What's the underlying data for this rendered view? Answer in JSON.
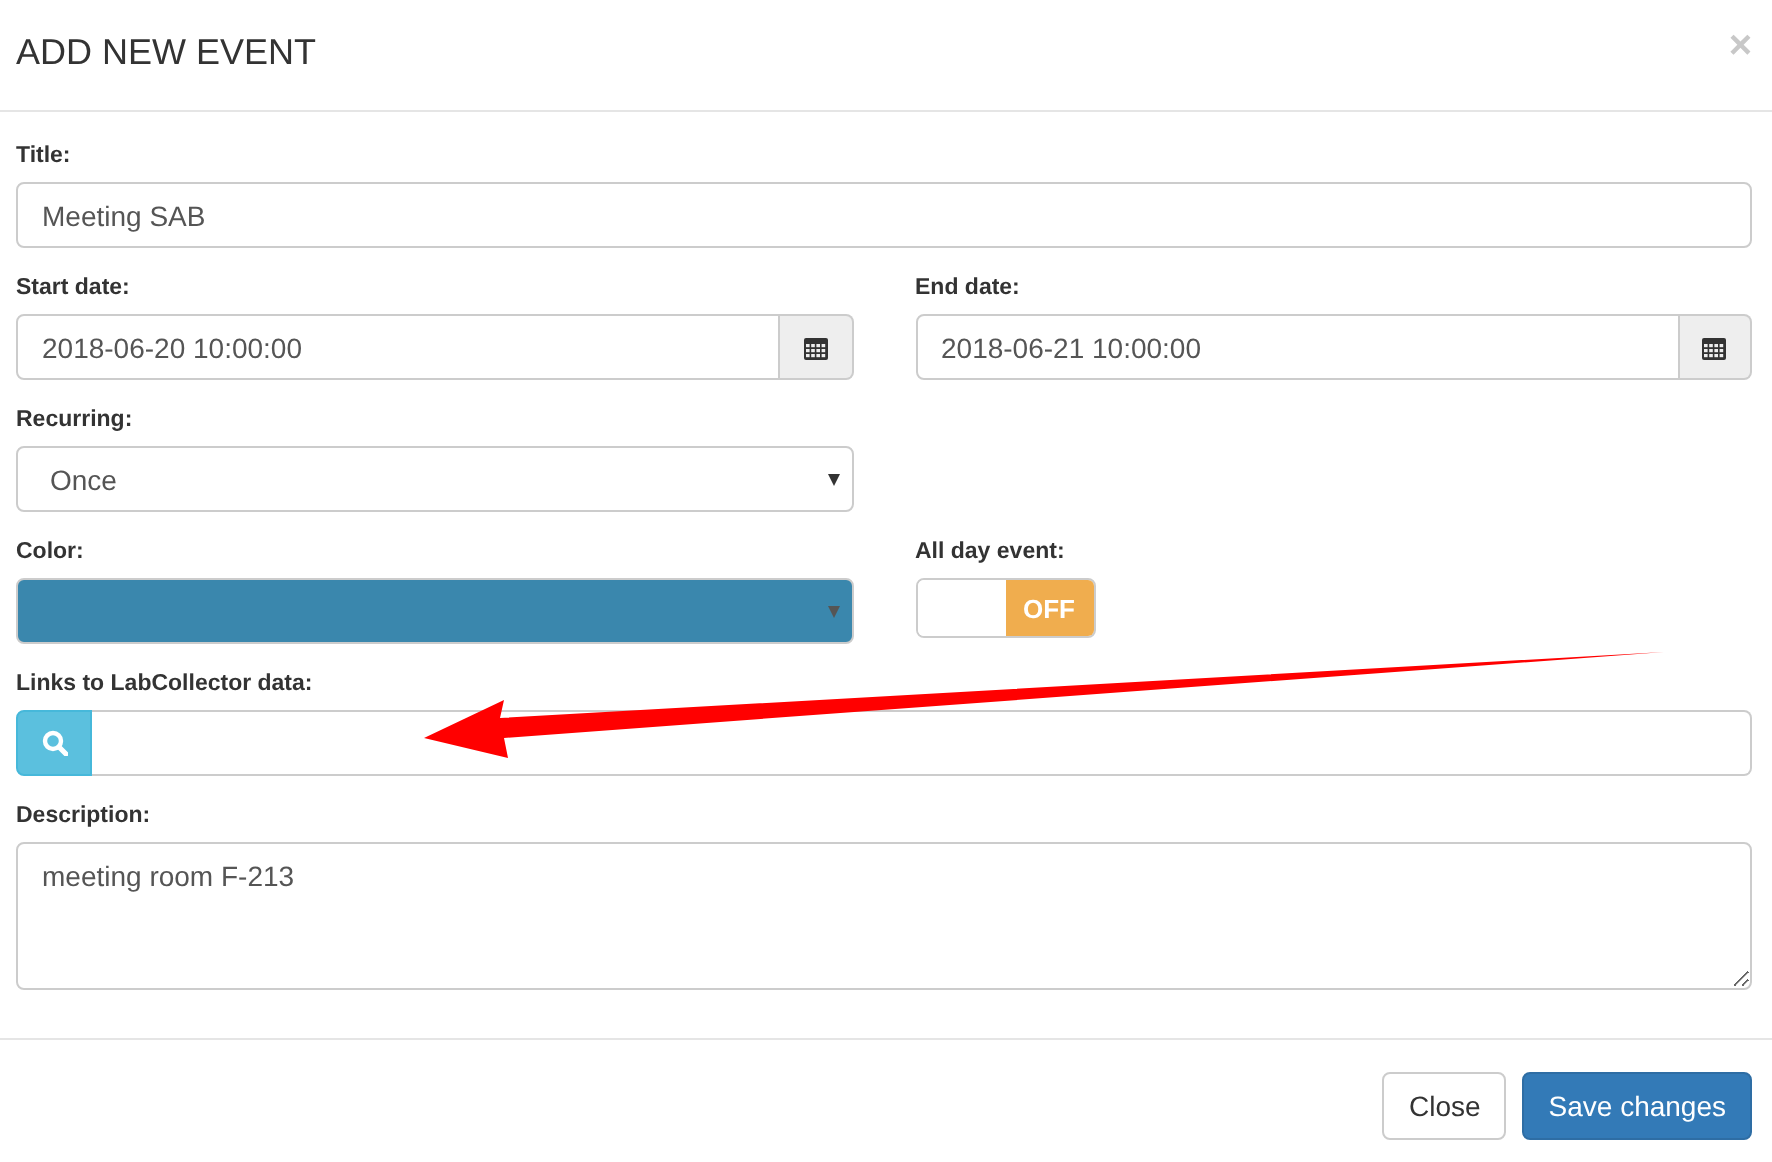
{
  "dialog": {
    "title": "ADD NEW EVENT",
    "close_glyph": "×"
  },
  "fields": {
    "title": {
      "label": "Title:",
      "value": "Meeting SAB"
    },
    "start_date": {
      "label": "Start date:",
      "value": "2018-06-20 10:00:00"
    },
    "end_date": {
      "label": "End date:",
      "value": "2018-06-21 10:00:00"
    },
    "recurring": {
      "label": "Recurring:",
      "value": "Once"
    },
    "color": {
      "label": "Color:",
      "color": "#3a87ad"
    },
    "all_day": {
      "label": "All day event:",
      "on": false,
      "off_text": "OFF"
    },
    "links": {
      "label": "Links to LabCollector data:"
    },
    "description": {
      "label": "Description:",
      "value": "meeting room F-213"
    }
  },
  "buttons": [
    {
      "label": "Close",
      "kind": "default"
    },
    {
      "label": "Save changes",
      "kind": "primary"
    }
  ]
}
